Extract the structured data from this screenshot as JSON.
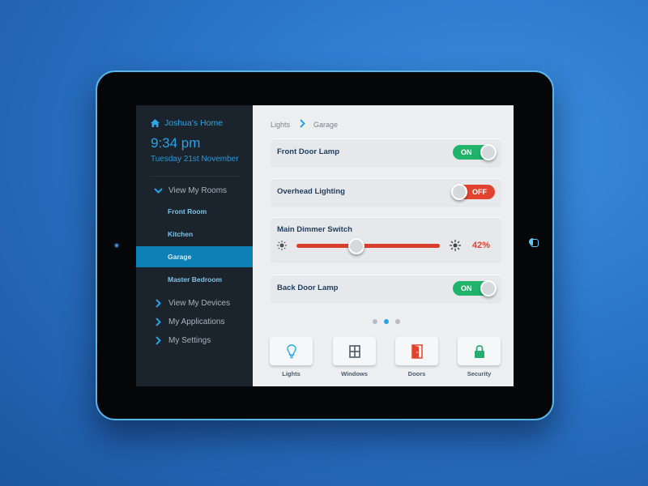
{
  "sidebar": {
    "home_label": "Joshua's Home",
    "time": "9:34 pm",
    "date": "Tuesday 21st November",
    "rooms_label": "View My Rooms",
    "rooms": [
      {
        "label": "Front Room",
        "active": false
      },
      {
        "label": "Kitchen",
        "active": false
      },
      {
        "label": "Garage",
        "active": true
      },
      {
        "label": "Master Bedroom",
        "active": false
      }
    ],
    "menu": [
      {
        "label": "View My Devices"
      },
      {
        "label": "My Applications"
      },
      {
        "label": "My Settings"
      }
    ]
  },
  "breadcrumb": {
    "parent": "Lights",
    "current": "Garage"
  },
  "devices": {
    "front_door_lamp": {
      "label": "Front Door Lamp",
      "state": "ON"
    },
    "overhead_lighting": {
      "label": "Overhead Lighting",
      "state": "OFF"
    },
    "main_dimmer": {
      "label": "Main Dimmer Switch",
      "value": 42,
      "value_label": "42%"
    },
    "back_door_lamp": {
      "label": "Back Door Lamp",
      "state": "ON"
    }
  },
  "pagination": {
    "pages": 3,
    "active_page": 2
  },
  "categories": [
    {
      "label": "Lights",
      "icon": "lightbulb-icon"
    },
    {
      "label": "Windows",
      "icon": "window-icon"
    },
    {
      "label": "Doors",
      "icon": "door-icon"
    },
    {
      "label": "Security",
      "icon": "lock-icon"
    }
  ],
  "colors": {
    "accent": "#22a3e6",
    "on": "#20b36a",
    "off": "#e2432f",
    "sidebar_bg": "#1b232c",
    "active_room": "#0d81b4"
  }
}
